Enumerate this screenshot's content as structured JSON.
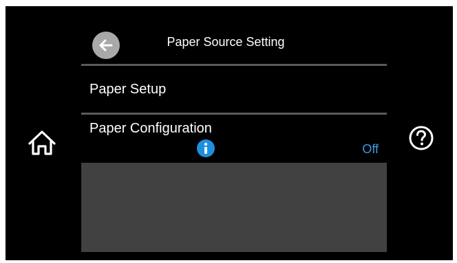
{
  "header": {
    "title": "Paper Source Setting",
    "back_icon": "arrow-left-icon"
  },
  "menu": {
    "items": [
      {
        "label": "Paper Setup"
      },
      {
        "label": "Paper Configuration",
        "value": "Off",
        "info_icon": "info-icon"
      }
    ]
  },
  "side": {
    "home_icon": "home-icon",
    "help_icon": "help-icon"
  },
  "colors": {
    "background": "#000000",
    "accent": "#3b9fe3",
    "info_icon": "#1e8fde",
    "back_button": "#a9a9a9",
    "panel": "#414141"
  }
}
